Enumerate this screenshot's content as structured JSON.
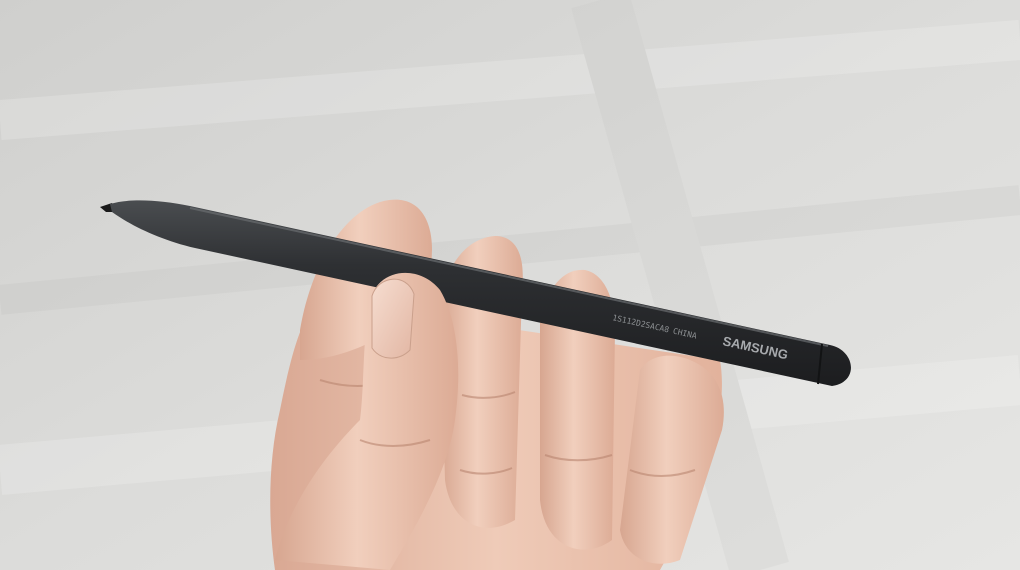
{
  "photo": {
    "subject": "stylus-pen-held-in-hand",
    "background_color": "#d6d6d4",
    "skin_color": "#e9c1ac",
    "pen_color": "#2b2d2f"
  },
  "pen": {
    "brand": "SAMSUNG",
    "serial": "1S112D2SACA8",
    "origin": "CHINA"
  }
}
